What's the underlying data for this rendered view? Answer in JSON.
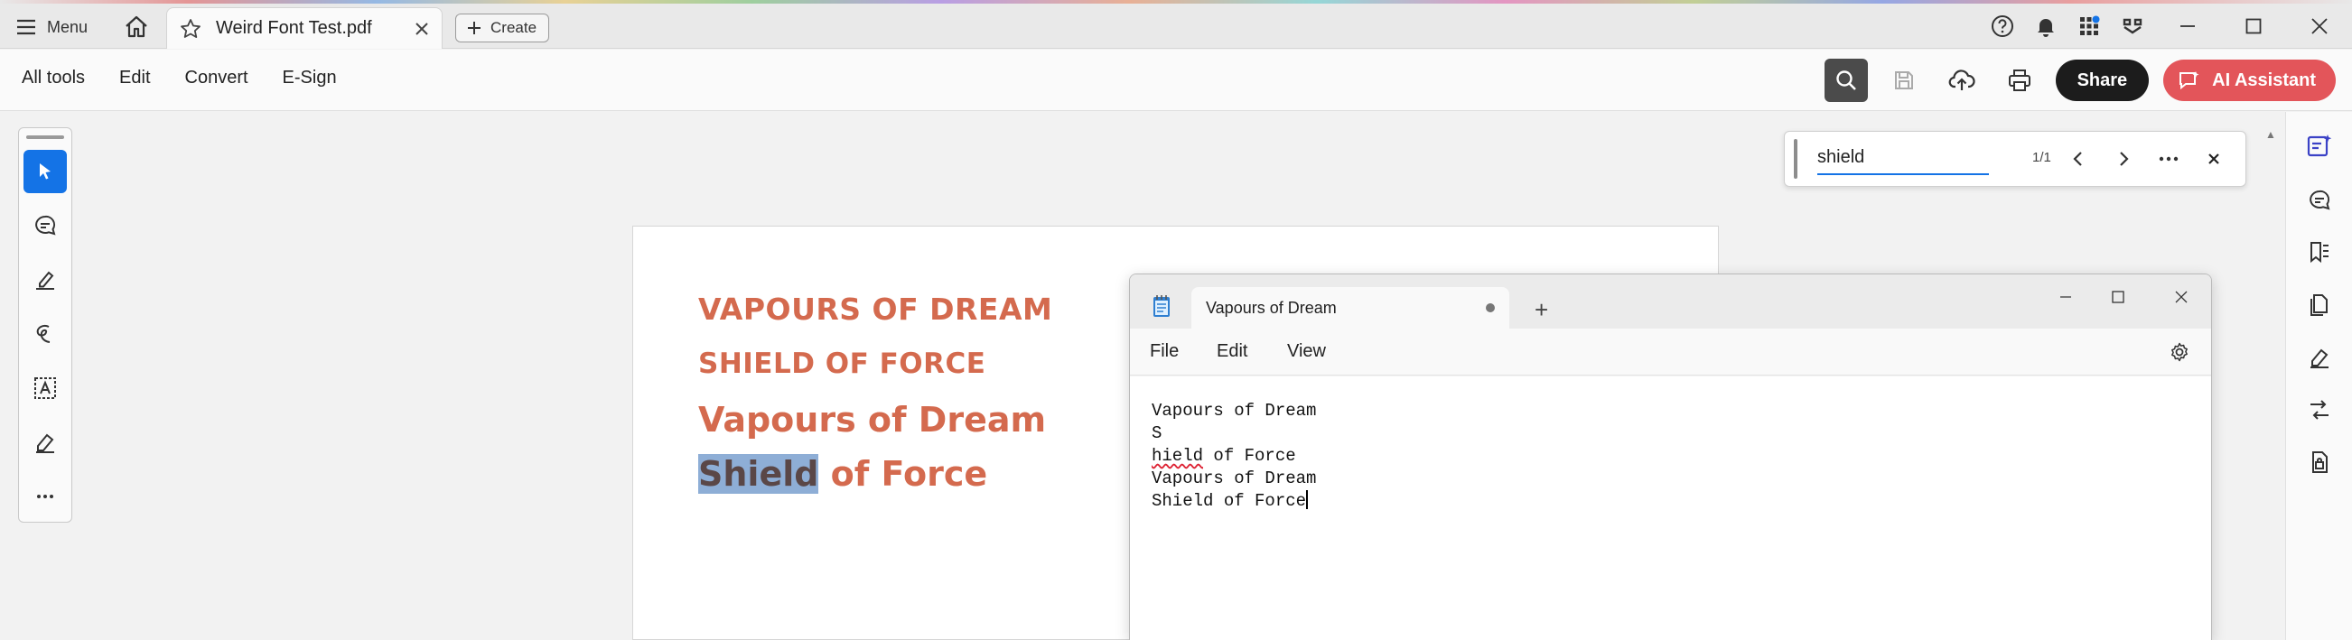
{
  "titlebar": {
    "menu_label": "Menu",
    "tab_title": "Weird Font Test.pdf",
    "create_label": "Create"
  },
  "toolbar": {
    "menu_items": [
      "All tools",
      "Edit",
      "Convert",
      "E-Sign"
    ],
    "share_label": "Share",
    "ai_label": "AI Assistant"
  },
  "find": {
    "query": "shield",
    "count": "1/1"
  },
  "pdf": {
    "lines": [
      "VAPOURS OF DREAM",
      "SHIELD OF FORCE",
      "Vapours of Dream",
      "Shield",
      " of Force"
    ]
  },
  "notepad": {
    "tab_title": "Vapours of Dream",
    "menu": {
      "file": "File",
      "edit": "Edit",
      "view": "View"
    },
    "content_lines": [
      "Vapours of Dream",
      "S",
      "hield",
      " of Force",
      "Vapours of Dream",
      "Shield of Force"
    ]
  },
  "colors": {
    "pdf_text": "#d46a4e",
    "highlight": "#8eaed6",
    "accent": "#1473e6",
    "ai_button": "#e3555a"
  }
}
